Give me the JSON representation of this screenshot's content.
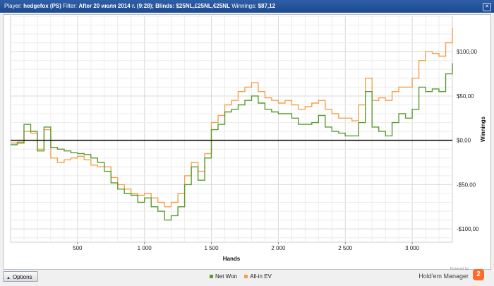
{
  "window": {
    "player_label": "Player:",
    "player_name": "hedgefox (PS)",
    "filter_label": "Filter:",
    "filter_value": "After 20 июля 2014 г. (9:28); Blinds: $25NL,£25NL,€25NL",
    "winnings_label": "Winnings:",
    "winnings_value": "$87,12"
  },
  "options_button": {
    "label": "Options",
    "icon": "triangle-up-icon"
  },
  "legend": [
    {
      "label": "Net Won",
      "color": "#5a9b2f"
    },
    {
      "label": "All-in EV",
      "color": "#f5a04a"
    }
  ],
  "brand": {
    "powered_by": "Powered by",
    "name": "Hold'em Manager",
    "logo_text": "2"
  },
  "chart_data": {
    "type": "line",
    "xlabel": "Hands",
    "ylabel": "Winnings",
    "xlim": [
      0,
      3300
    ],
    "ylim": [
      -115,
      140
    ],
    "x_ticks": [
      500,
      1000,
      1500,
      2000,
      2500,
      3000
    ],
    "x_tick_labels": [
      "500",
      "1 000",
      "1 500",
      "2 000",
      "2 500",
      "3 000"
    ],
    "y_ticks": [
      -100,
      -50,
      0,
      50,
      100
    ],
    "y_tick_labels": [
      "-$100,00",
      "-$50,00",
      "$0,00",
      "$50,00",
      "$100,00"
    ],
    "grid": true,
    "series": [
      {
        "name": "Net Won",
        "color": "#5a9b2f",
        "x": [
          0,
          50,
          100,
          150,
          200,
          250,
          300,
          350,
          400,
          450,
          500,
          550,
          600,
          650,
          700,
          750,
          800,
          850,
          900,
          950,
          1000,
          1050,
          1100,
          1150,
          1200,
          1250,
          1300,
          1350,
          1400,
          1450,
          1500,
          1550,
          1600,
          1650,
          1700,
          1750,
          1800,
          1850,
          1900,
          1950,
          2000,
          2050,
          2100,
          2150,
          2200,
          2250,
          2300,
          2350,
          2400,
          2450,
          2500,
          2550,
          2600,
          2650,
          2700,
          2750,
          2800,
          2850,
          2900,
          2950,
          3000,
          3050,
          3100,
          3150,
          3200,
          3250,
          3300
        ],
        "values": [
          -5,
          -3,
          18,
          10,
          -12,
          15,
          -8,
          -10,
          -12,
          -14,
          -15,
          -16,
          -20,
          -25,
          -35,
          -48,
          -55,
          -60,
          -62,
          -70,
          -65,
          -75,
          -80,
          -90,
          -85,
          -75,
          -50,
          -30,
          -45,
          -20,
          12,
          18,
          32,
          35,
          40,
          45,
          50,
          42,
          35,
          32,
          30,
          30,
          25,
          18,
          18,
          20,
          28,
          15,
          10,
          8,
          5,
          5,
          20,
          55,
          15,
          10,
          5,
          20,
          30,
          25,
          35,
          60,
          55,
          58,
          55,
          75,
          87
        ]
      },
      {
        "name": "All-in EV",
        "color": "#f5a04a",
        "x": [
          0,
          50,
          100,
          150,
          200,
          250,
          300,
          350,
          400,
          450,
          500,
          550,
          600,
          650,
          700,
          750,
          800,
          850,
          900,
          950,
          1000,
          1050,
          1100,
          1150,
          1200,
          1250,
          1300,
          1350,
          1400,
          1450,
          1500,
          1550,
          1600,
          1650,
          1700,
          1750,
          1800,
          1850,
          1900,
          1950,
          2000,
          2050,
          2100,
          2150,
          2200,
          2250,
          2300,
          2350,
          2400,
          2450,
          2500,
          2550,
          2600,
          2650,
          2700,
          2750,
          2800,
          2850,
          2900,
          2950,
          3000,
          3050,
          3100,
          3150,
          3200,
          3250,
          3300
        ],
        "values": [
          -3,
          -2,
          10,
          8,
          -10,
          12,
          -20,
          -25,
          -22,
          -20,
          -18,
          -22,
          -28,
          -30,
          -30,
          -42,
          -50,
          -55,
          -60,
          -62,
          -60,
          -65,
          -70,
          -75,
          -70,
          -60,
          -40,
          -25,
          -35,
          -15,
          20,
          28,
          40,
          45,
          55,
          60,
          65,
          55,
          48,
          45,
          42,
          45,
          40,
          35,
          38,
          42,
          45,
          35,
          30,
          25,
          25,
          22,
          40,
          70,
          45,
          48,
          45,
          55,
          60,
          60,
          70,
          90,
          100,
          98,
          95,
          110,
          127
        ]
      }
    ]
  }
}
